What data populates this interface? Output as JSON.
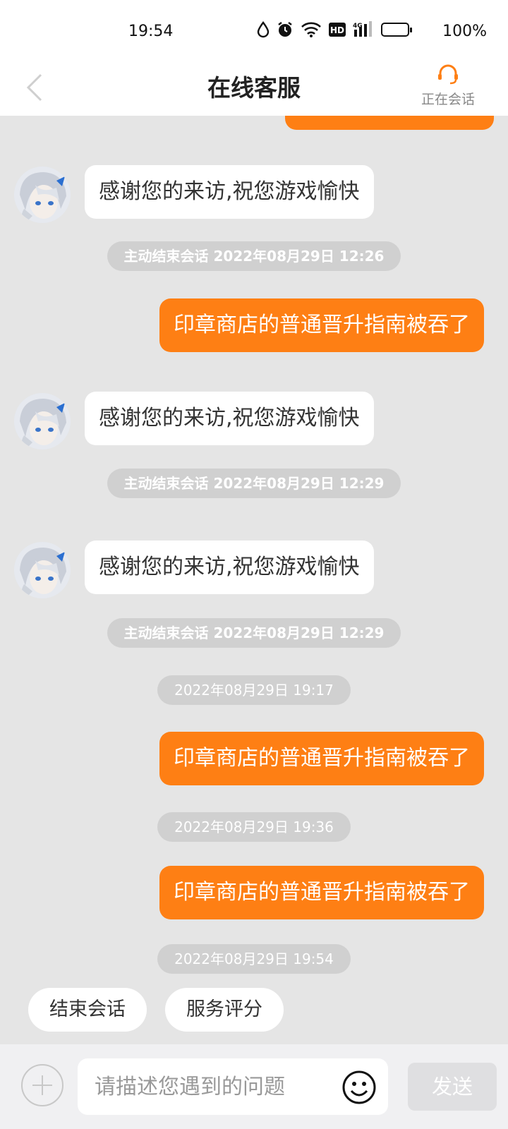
{
  "status_bar": {
    "time": "19:54",
    "battery_percent": "100%"
  },
  "nav": {
    "title": "在线客服",
    "session_label": "正在会话"
  },
  "messages": {
    "agent_reply_1": "感谢您的来访,祝您游戏愉快",
    "system_1": "主动结束会话 2022年08月29日 12:26",
    "user_1": "印章商店的普通晋升指南被吞了",
    "agent_reply_2": "感谢您的来访,祝您游戏愉快",
    "system_2": "主动结束会话 2022年08月29日 12:29",
    "agent_reply_3": "感谢您的来访,祝您游戏愉快",
    "system_3": "主动结束会话 2022年08月29日 12:29",
    "timestamp_1": "2022年08月29日 19:17",
    "user_2": "印章商店的普通晋升指南被吞了",
    "timestamp_2": "2022年08月29日 19:36",
    "user_3": "印章商店的普通晋升指南被吞了",
    "timestamp_3": "2022年08月29日 19:54"
  },
  "quick_actions": {
    "end_session": "结束会话",
    "rate_service": "服务评分"
  },
  "input": {
    "placeholder": "请描述您遇到的问题",
    "send_label": "发送"
  },
  "colors": {
    "accent": "#fe7f14",
    "background": "#e5e5e5",
    "system_pill": "#d0d0d0"
  }
}
